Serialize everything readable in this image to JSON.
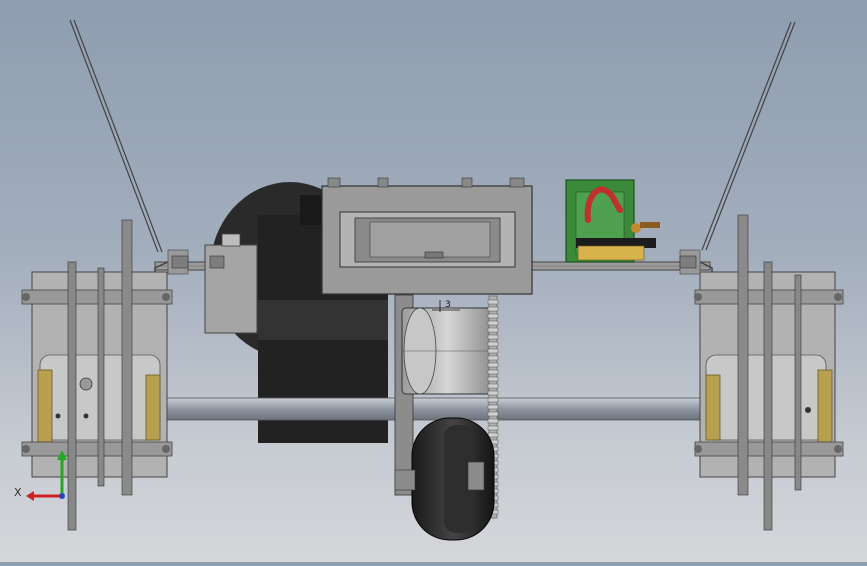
{
  "viewport": {
    "axis_triad": {
      "x_label": "X",
      "colors": {
        "x": "#cc2222",
        "y": "#22aa22",
        "z": "#2244cc"
      }
    },
    "dimension_note": "3"
  },
  "colors": {
    "plate": "#a9a9a9",
    "dark_part": "#2a2a2a",
    "bronze": "#b8a050",
    "circuit_board": "#3a8a3a",
    "red_wire": "#c03030"
  }
}
